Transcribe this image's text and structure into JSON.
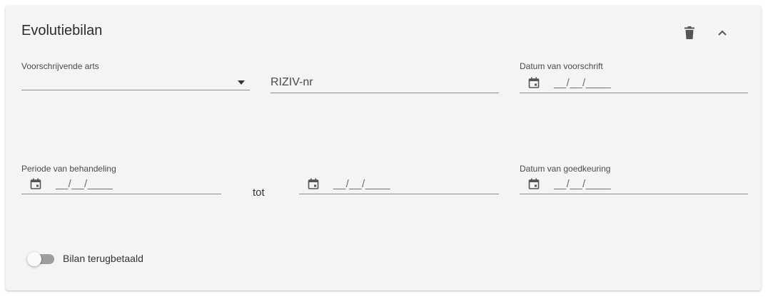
{
  "card": {
    "title": "Evolutiebilan"
  },
  "icons": {
    "delete": "trash-icon",
    "collapse": "chevron-up-icon",
    "dropdown": "caret-down-icon",
    "calendar": "calendar-icon"
  },
  "fields": {
    "voorschrijvende_arts": {
      "label": "Voorschrijvende arts",
      "value": ""
    },
    "riziv": {
      "placeholder": "RIZIV-nr"
    },
    "datum_voorschrift": {
      "label": "Datum van voorschrift",
      "mask": "__/__/____"
    },
    "periode_van": {
      "label": "Periode van behandeling",
      "mask": "__/__/____"
    },
    "tot_label": "tot",
    "periode_tot": {
      "mask": "__/__/____"
    },
    "datum_goedkeuring": {
      "label": "Datum van goedkeuring",
      "mask": "__/__/____"
    }
  },
  "toggle": {
    "label": "Bilan terugbetaald",
    "checked": false
  }
}
